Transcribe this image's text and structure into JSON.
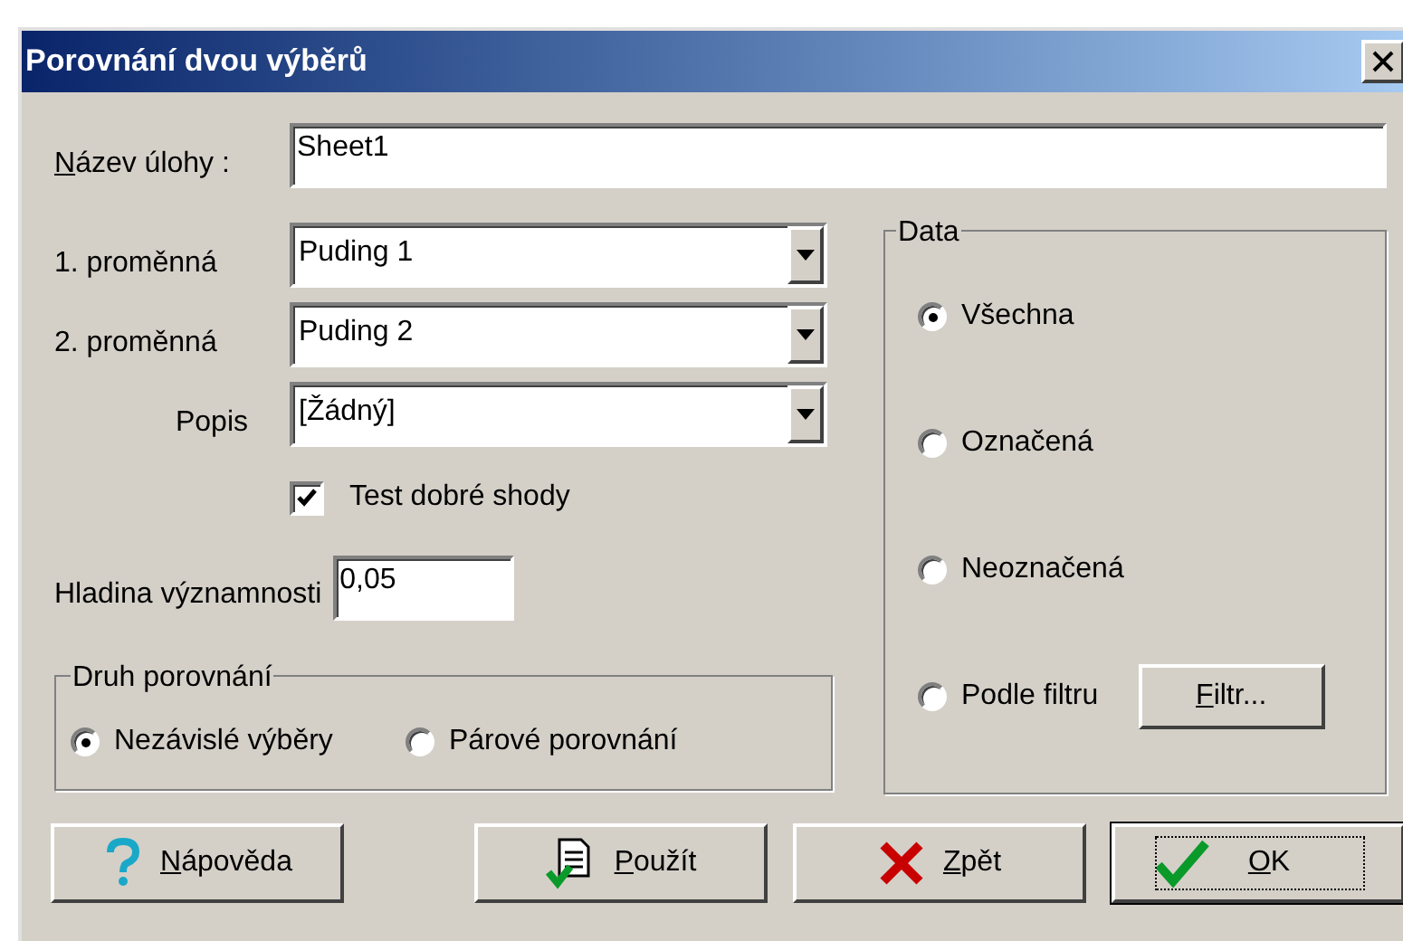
{
  "window": {
    "title": "Porovnání dvou výběrů"
  },
  "task_name": {
    "label": "Název úlohy :",
    "underline_first": true,
    "value": "Sheet1"
  },
  "variables": [
    {
      "label": "1. proměnná",
      "value": "Puding 1"
    },
    {
      "label": "2. proměnná",
      "value": "Puding 2"
    },
    {
      "label": "Popis",
      "value": "[Žádný]"
    }
  ],
  "goodness_of_fit": {
    "label": "Test dobré shody",
    "checked": true
  },
  "significance": {
    "label": "Hladina významnosti",
    "value": "0,05"
  },
  "comparison": {
    "title": "Druh porovnání",
    "options": [
      {
        "label": "Nezávislé výběry",
        "selected": true
      },
      {
        "label": "Párové porovnání",
        "selected": false
      }
    ]
  },
  "data": {
    "title": "Data",
    "options": [
      {
        "label": "Všechna",
        "selected": true
      },
      {
        "label": "Označená",
        "selected": false
      },
      {
        "label": "Neoznačená",
        "selected": false
      },
      {
        "label": "Podle filtru",
        "selected": false
      }
    ],
    "filter_button": {
      "label": "Filtr...",
      "underline_first": true
    }
  },
  "buttons": [
    {
      "label": "Nápověda",
      "kind": "help",
      "underline_first": true,
      "default": false
    },
    {
      "label": "Použít",
      "kind": "apply",
      "underline_first": true,
      "default": false
    },
    {
      "label": "Zpět",
      "kind": "cancel",
      "underline_first": true,
      "default": false
    },
    {
      "label": "OK",
      "kind": "ok",
      "underline_first": true,
      "default": true
    }
  ]
}
